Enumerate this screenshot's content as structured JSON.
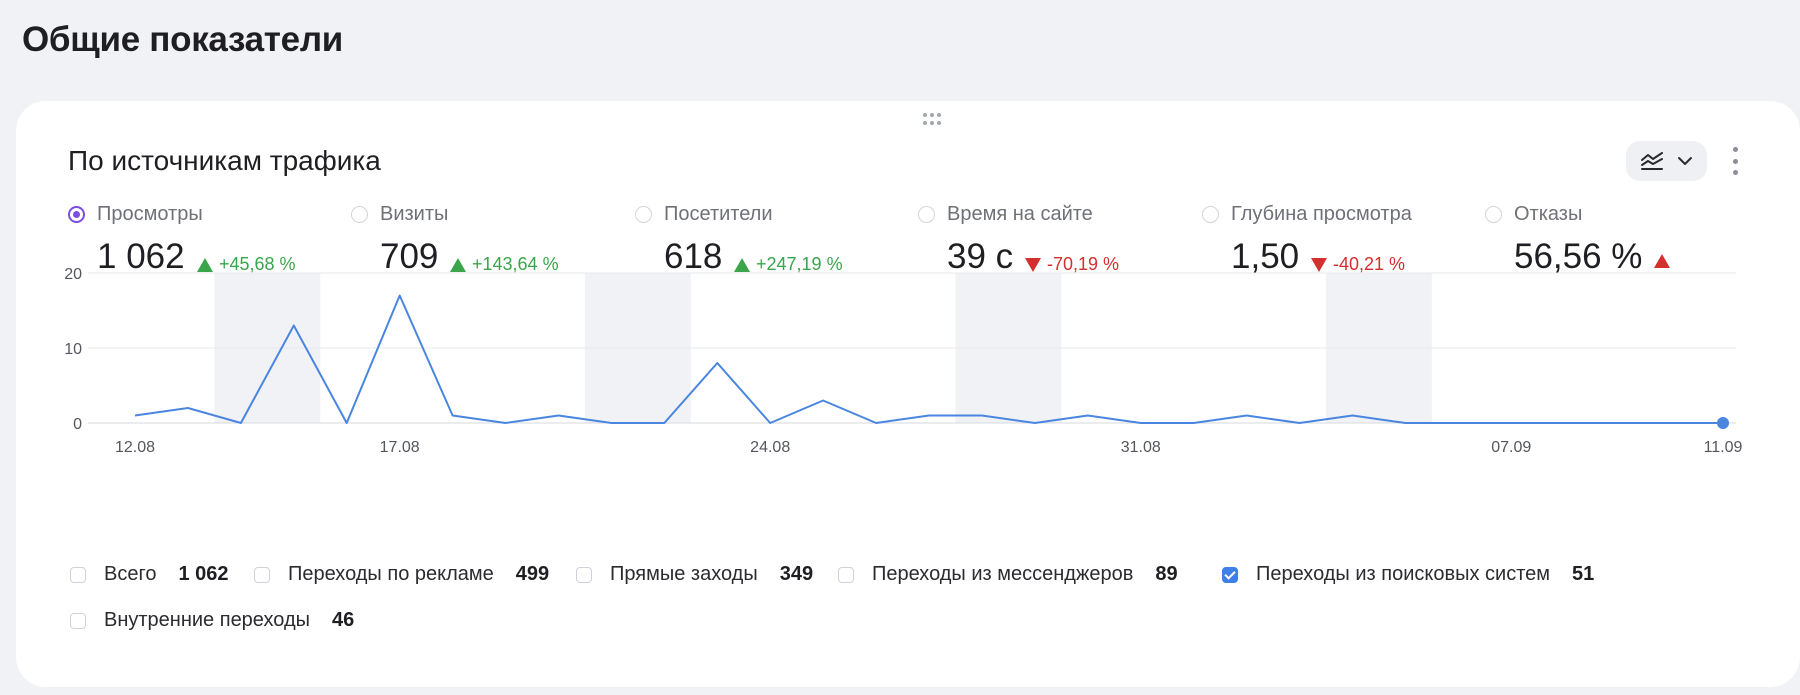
{
  "page": {
    "title": "Общие показатели"
  },
  "card": {
    "title": "По источникам трафика",
    "chart_type_icon": "area-chart-icon",
    "more_icon": "kebab-menu-icon"
  },
  "metrics": [
    {
      "label": "Просмотры",
      "value": "1 062",
      "change": "+45,68 %",
      "trend": "up",
      "selected": true
    },
    {
      "label": "Визиты",
      "value": "709",
      "change": "+143,64 %",
      "trend": "up",
      "selected": false
    },
    {
      "label": "Посетители",
      "value": "618",
      "change": "+247,19 %",
      "trend": "up",
      "selected": false
    },
    {
      "label": "Время на сайте",
      "value": "39 с",
      "change": "-70,19 %",
      "trend": "down",
      "selected": false
    },
    {
      "label": "Глубина просмотра",
      "value": "1,50",
      "change": "-40,21 %",
      "trend": "down",
      "selected": false
    },
    {
      "label": "Отказы",
      "value": "56,56 %",
      "change": "",
      "trend": "up-bad",
      "selected": false
    }
  ],
  "colors": {
    "accent": "#7b4de0",
    "line": "#4a86e0",
    "up": "#3aa54a",
    "down": "#d3302f",
    "checkbox": "#3f7fe8"
  },
  "chart_data": {
    "type": "line",
    "x": [
      "12.08",
      "13.08",
      "14.08",
      "15.08",
      "16.08",
      "17.08",
      "18.08",
      "19.08",
      "20.08",
      "21.08",
      "22.08",
      "23.08",
      "24.08",
      "25.08",
      "26.08",
      "27.08",
      "28.08",
      "29.08",
      "30.08",
      "31.08",
      "01.09",
      "02.09",
      "03.09",
      "04.09",
      "05.09",
      "06.09",
      "07.09",
      "08.09",
      "09.09",
      "10.09",
      "11.09"
    ],
    "tick_labels": [
      "12.08",
      "17.08",
      "24.08",
      "31.08",
      "07.09",
      "11.09"
    ],
    "series": [
      {
        "name": "Переходы из поисковых систем",
        "values": [
          1,
          2,
          0,
          13,
          0,
          17,
          1,
          0,
          1,
          0,
          0,
          8,
          0,
          3,
          0,
          1,
          1,
          0,
          1,
          0,
          0,
          1,
          0,
          1,
          0,
          0,
          0,
          0,
          0,
          0,
          0
        ]
      }
    ],
    "y_ticks": [
      "0",
      "10",
      "20"
    ],
    "ylim": [
      0,
      20
    ],
    "weekend_shading": [
      [
        "14.08",
        "15.08"
      ],
      [
        "21.08",
        "22.08"
      ],
      [
        "28.08",
        "29.08"
      ],
      [
        "04.09",
        "05.09"
      ]
    ],
    "grid": true
  },
  "legend": [
    {
      "label": "Всего",
      "count": "1 062",
      "checked": false
    },
    {
      "label": "Переходы по рекламе",
      "count": "499",
      "checked": false
    },
    {
      "label": "Прямые заходы",
      "count": "349",
      "checked": false
    },
    {
      "label": "Переходы из мессенджеров",
      "count": "89",
      "checked": false
    },
    {
      "label": "Переходы из поисковых систем",
      "count": "51",
      "checked": true
    },
    {
      "label": "Внутренние переходы",
      "count": "46",
      "checked": false
    }
  ]
}
